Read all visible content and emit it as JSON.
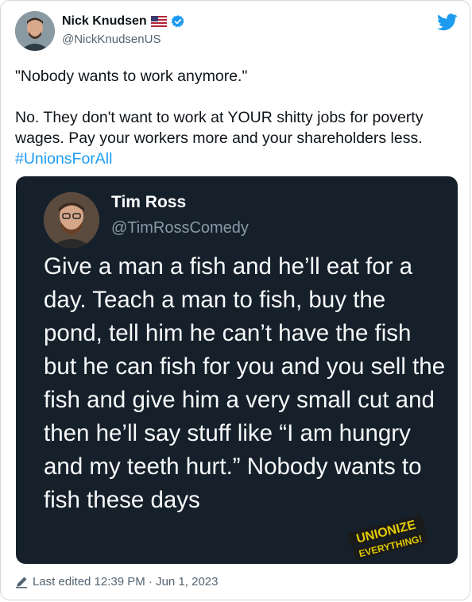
{
  "author": {
    "name": "Nick Knudsen",
    "handle": "@NickKnudsenUS",
    "flag_icon": "us-flag-icon",
    "verified_icon": "verified-badge-icon"
  },
  "tweet": {
    "line1": "\"Nobody wants to work anymore.\"",
    "body": "No. They don't want to work at YOUR shitty jobs for poverty wages. Pay your workers more and your shareholders less.",
    "hashtag": "#UnionsForAll"
  },
  "embedded": {
    "name": "Tim Ross",
    "handle": "@TimRossComedy",
    "text": "Give a man a fish and he’ll eat for a day. Teach a man to fish, buy the pond, tell him he can’t have the fish but he can fish for you and you sell the fish and give him a very small cut and then he’ll say stuff like “I am hungry and my teeth hurt.” Nobody wants to fish these days",
    "stamp_line1": "UNIONIZE",
    "stamp_line2": "EVERYTHING!"
  },
  "footer": {
    "edited": "Last edited 12:39 PM · Jun 1, 2023"
  },
  "colors": {
    "accent": "#1d9bf0",
    "media_bg": "#15202b",
    "stamp": "#d9c400"
  },
  "icons": {
    "brand": "twitter-bird-icon",
    "edit": "pencil-icon"
  }
}
